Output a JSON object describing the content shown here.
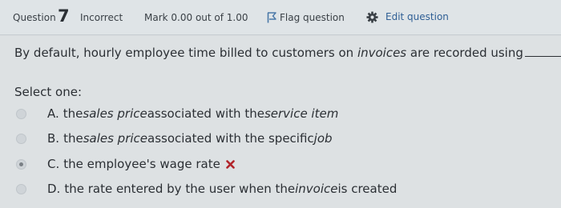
{
  "info": {
    "question_label": "Question",
    "question_number": "7",
    "state": "Incorrect",
    "grade": "Mark 0.00 out of 1.00",
    "flag_label": "Flag question",
    "edit_label": "Edit question"
  },
  "question": {
    "text_before": "By default, hourly employee time billed to customers on ",
    "text_emphasis": "invoices",
    "text_after": " are recorded using",
    "blank_suffix": "."
  },
  "select_one_label": "Select one:",
  "options": [
    {
      "letter": "A.",
      "parts": [
        "the ",
        "sales price",
        " associated with the ",
        "service item"
      ],
      "selected": false
    },
    {
      "letter": "B.",
      "parts": [
        "the ",
        "sales price",
        " associated with the specific ",
        "job"
      ],
      "selected": false
    },
    {
      "letter": "C.",
      "parts": [
        "the employee's wage rate"
      ],
      "selected": true,
      "marked_incorrect": true
    },
    {
      "letter": "D.",
      "parts": [
        "the rate entered by the user when the ",
        "invoice",
        " is created"
      ],
      "selected": false
    }
  ],
  "colors": {
    "background": "#d9dde0",
    "link": "#2f5f95",
    "incorrect_mark": "#b1242a",
    "flag": "#4a78a8"
  },
  "icons": {
    "flag": "flag-icon",
    "edit": "gear-icon",
    "incorrect": "cross-icon"
  }
}
